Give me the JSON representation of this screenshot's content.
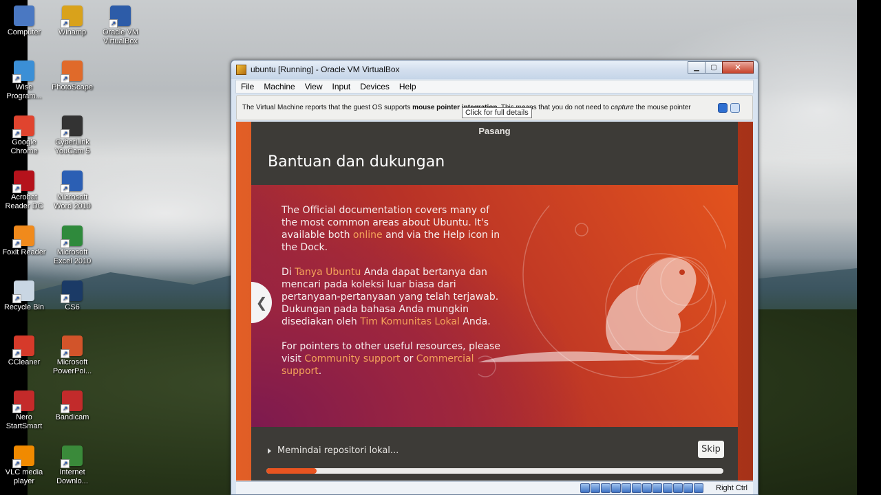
{
  "desktop": {
    "icons_col1": [
      {
        "label": "Computer",
        "icon": "computer-icon",
        "color": "#4a78c2"
      },
      {
        "label": "Wise Program...",
        "icon": "wise-program-icon",
        "color": "#3b8fd6"
      },
      {
        "label": "Google Chrome",
        "icon": "chrome-icon",
        "color": "#e0442f"
      },
      {
        "label": "Acrobat Reader DC",
        "icon": "acrobat-icon",
        "color": "#b5121b"
      },
      {
        "label": "Foxit Reader",
        "icon": "foxit-icon",
        "color": "#f08a1c"
      },
      {
        "label": "Recycle Bin",
        "icon": "recycle-bin-icon",
        "color": "#c9d6e3"
      },
      {
        "label": "CCleaner",
        "icon": "ccleaner-icon",
        "color": "#d63a2a"
      },
      {
        "label": "Nero StartSmart",
        "icon": "nero-icon",
        "color": "#c42a2a"
      },
      {
        "label": "VLC media player",
        "icon": "vlc-icon",
        "color": "#f08a00"
      }
    ],
    "icons_col2": [
      {
        "label": "Winamp",
        "icon": "winamp-icon",
        "color": "#d9a21b"
      },
      {
        "label": "PhotoScape",
        "icon": "photoscape-icon",
        "color": "#e06a2a"
      },
      {
        "label": "CyberLink YouCam 5",
        "icon": "youcam-icon",
        "color": "#333333"
      },
      {
        "label": "Microsoft Word 2010",
        "icon": "word-icon",
        "color": "#2b5fb4"
      },
      {
        "label": "Microsoft Excel 2010",
        "icon": "excel-icon",
        "color": "#2f8a3c"
      },
      {
        "label": "CS6",
        "icon": "photoshop-icon",
        "color": "#1b3a66"
      },
      {
        "label": "Microsoft PowerPoi...",
        "icon": "powerpoint-icon",
        "color": "#d2542a"
      },
      {
        "label": "Bandicam",
        "icon": "bandicam-icon",
        "color": "#c22b2b"
      },
      {
        "label": "Internet Downlo...",
        "icon": "idm-icon",
        "color": "#3a8a3a"
      }
    ],
    "icons_col3": [
      {
        "label": "Oracle VM VirtualBox",
        "icon": "virtualbox-icon",
        "color": "#2d5ca8"
      }
    ]
  },
  "window": {
    "title": "ubuntu [Running] - Oracle VM VirtualBox",
    "menu": [
      "File",
      "Machine",
      "View",
      "Input",
      "Devices",
      "Help"
    ],
    "notice": {
      "part1": "The Virtual Machine reports that the guest OS supports ",
      "bold": "mouse pointer integration",
      "part2": ". This means that you do not need to ",
      "italic": "capture",
      "part3": " the mouse pointer"
    },
    "tooltip": "Click for full details",
    "status_label": "Right Ctrl"
  },
  "installer": {
    "top_label": "Pasang",
    "heading": "Bantuan dan dukungan",
    "p1": {
      "a": "The Official documentation covers many of the most common areas about Ubuntu. It's available both ",
      "link": "online",
      "b": " and via the Help icon in the Dock."
    },
    "p2": {
      "a": "Di ",
      "link1": "Tanya Ubuntu",
      "b": " Anda dapat bertanya dan mencari pada koleksi luar biasa dari pertanyaan-pertanyaan yang telah terjawab. Dukungan pada bahasa Anda mungkin disediakan oleh ",
      "link2": "Tim Komunitas Lokal",
      "c": " Anda."
    },
    "p3": {
      "a": "For pointers to other useful resources, please visit ",
      "link1": "Community support",
      "b": " or ",
      "link2": "Commercial support",
      "c": "."
    },
    "status": "Memindai repositori lokal...",
    "skip": "Skip",
    "progress": 0.11,
    "prev_symbol": "❮"
  },
  "colors": {
    "ubuntu_orange": "#e95420",
    "link": "#f4a35a",
    "dark_panel": "#3d3b37"
  }
}
